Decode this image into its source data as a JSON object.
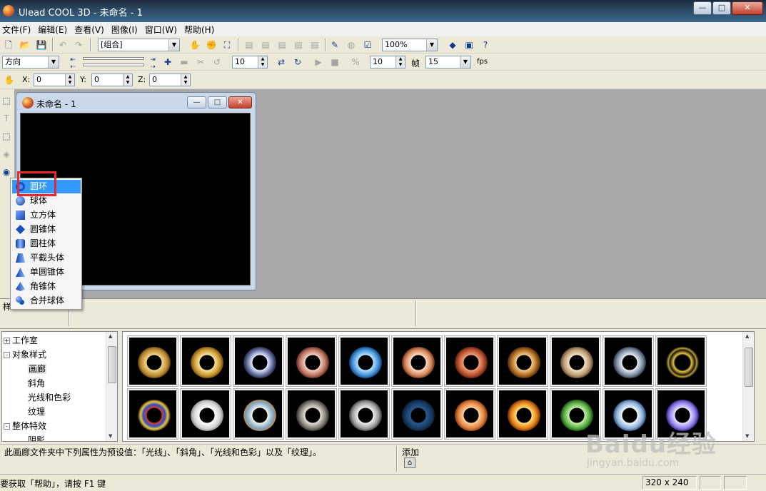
{
  "window": {
    "title": "Ulead COOL 3D - 未命名 - 1",
    "minimize": "—",
    "maximize": "□",
    "close": "✕"
  },
  "menu": [
    "文件(F)",
    "编辑(E)",
    "查看(V)",
    "图像(I)",
    "窗口(W)",
    "帮助(H)"
  ],
  "toolbar1": {
    "object_select": "[组合]",
    "zoom": "100%"
  },
  "toolbar2": {
    "mode_select": "方向",
    "value1": "10",
    "value2": "10",
    "frames_label": "帧",
    "frames_value": "15",
    "fps_label": "fps"
  },
  "toolbar3": {
    "x_label": "X:",
    "x_value": "0",
    "y_label": "Y:",
    "y_value": "0",
    "z_label": "Z:",
    "z_value": "0"
  },
  "child_window": {
    "title": "未命名 - 1",
    "minimize": "—",
    "maximize": "□",
    "close": "✕"
  },
  "shape_menu": {
    "items": [
      {
        "label": "圆环",
        "icon": "torus-icon",
        "selected": true
      },
      {
        "label": "球体",
        "icon": "sphere-icon"
      },
      {
        "label": "立方体",
        "icon": "cube-icon"
      },
      {
        "label": "圆锥体",
        "icon": "cone-icon"
      },
      {
        "label": "圆柱体",
        "icon": "cylinder-icon"
      },
      {
        "label": "平截头体",
        "icon": "frustum-icon"
      },
      {
        "label": "单圆锥体",
        "icon": "single-cone-icon"
      },
      {
        "label": "角锥体",
        "icon": "pyramid-icon"
      },
      {
        "label": "合并球体",
        "icon": "merged-sphere-icon"
      }
    ]
  },
  "strip_label": "样",
  "tree": {
    "nodes": [
      {
        "label": "工作室",
        "expander": "+"
      },
      {
        "label": "对象样式",
        "expander": "-"
      },
      {
        "label": "画廊",
        "selected": true
      },
      {
        "label": "斜角"
      },
      {
        "label": "光线和色彩"
      },
      {
        "label": "纹理"
      },
      {
        "label": "整体特效",
        "expander": "-"
      },
      {
        "label": "阴影"
      }
    ]
  },
  "description": "此画廊文件夹中下列属性为预设值：「光线」、「斜角」、「光线和色彩」以及「纹理」。",
  "add_label": "添加",
  "status": {
    "message": "要获取「帮助」，请按 F1 键",
    "dimensions": "320 x 240"
  },
  "watermark": {
    "brand": "Baidu经验",
    "url": "jingyan.baidu.com"
  },
  "colors": {
    "menu_highlight": "#3399ff",
    "annotation_box": "#e8282c",
    "workspace": "#a8a8a8"
  }
}
